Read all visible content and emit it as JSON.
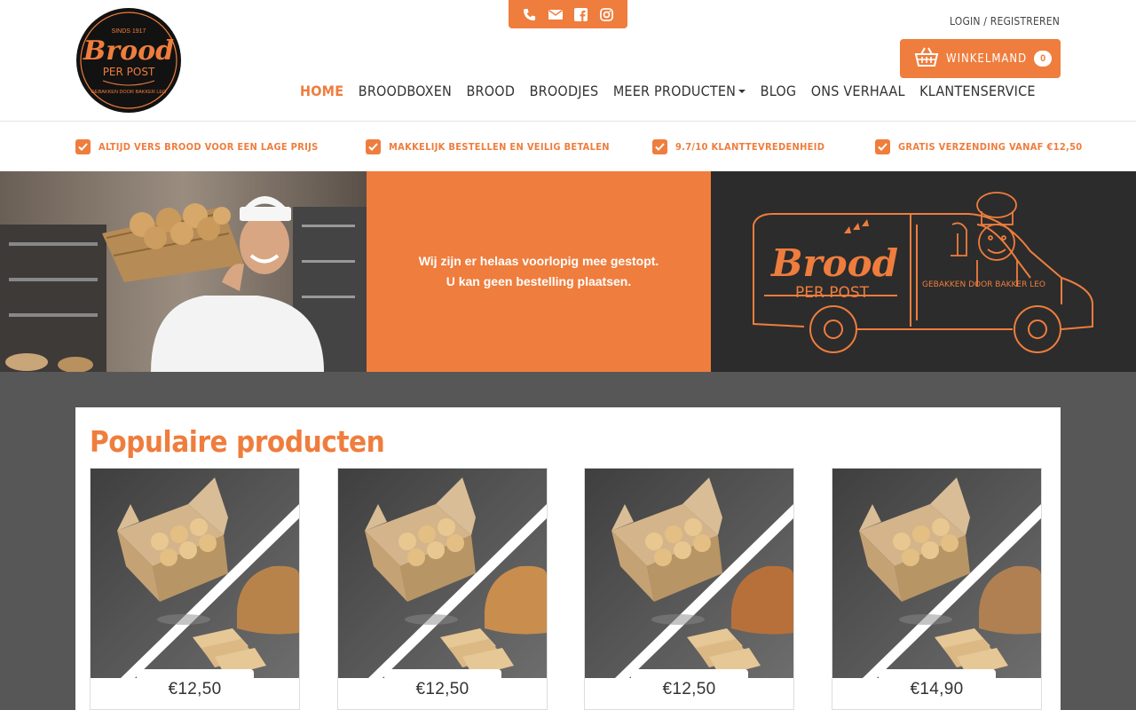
{
  "brand": {
    "logo_top_text": "SINDS 1917",
    "logo_main": "Brood",
    "logo_sub": "PER POST",
    "logo_ring": "GEBAKKEN DOOR BAKKER LEO",
    "accent_color": "#ef7d3d"
  },
  "social": [
    "phone-icon",
    "envelope-icon",
    "facebook-icon",
    "instagram-icon"
  ],
  "header": {
    "login_label": "LOGIN / REGISTREREN",
    "cart_label": "WINKELMAND",
    "cart_count": "0"
  },
  "nav": {
    "items": [
      {
        "label": "HOME",
        "active": true
      },
      {
        "label": "BROODBOXEN"
      },
      {
        "label": "BROOD"
      },
      {
        "label": "BROODJES"
      },
      {
        "label": "MEER PRODUCTEN",
        "dropdown": true
      },
      {
        "label": "BLOG"
      },
      {
        "label": "ONS VERHAAL"
      },
      {
        "label": "KLANTENSERVICE"
      }
    ]
  },
  "usps": [
    "ALTIJD VERS BROOD VOOR EEN LAGE PRIJS",
    "MAKKELIJK BESTELLEN EN VEILIG BETALEN",
    "9.7/10 KLANTTEVREDENHEID",
    "GRATIS VERZENDING VANAF €12,50"
  ],
  "hero": {
    "line1": "Wij zijn er helaas voorlopig mee gestopt.",
    "line2": "U kan geen bestelling plaatsen.",
    "van_brand": "Brood",
    "van_sub": "PER POST",
    "van_tagline": "GEBAKKEN DOOR BAKKER LEO"
  },
  "products": {
    "title": "Populaire producten",
    "items": [
      {
        "price": "€12,50"
      },
      {
        "price": "€12,50"
      },
      {
        "price": "€12,50"
      },
      {
        "price": "€14,90"
      }
    ]
  }
}
